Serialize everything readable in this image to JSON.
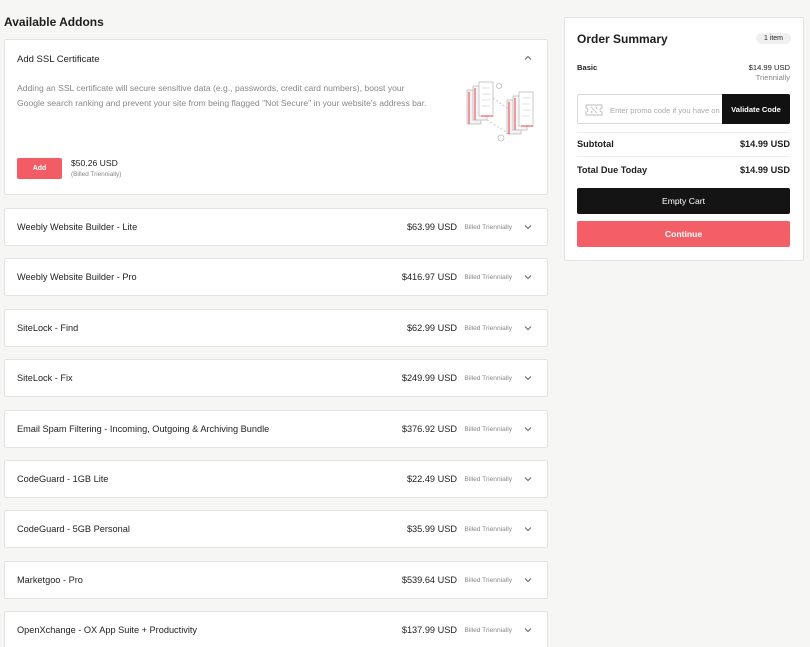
{
  "section_title": "Available Addons",
  "expanded_addon": {
    "name": "Add SSL Certificate",
    "description": "Adding an SSL certificate will secure sensitive data (e.g., passwords, credit card numbers), boost your Google search ranking and prevent your site from being flagged \"Not Secure\" in your website's address bar.",
    "add_label": "Add",
    "price": "$50.26 USD",
    "billing": "(Billed Triennially)",
    "icons": {
      "collapse": "chevron-up-icon",
      "illustration": "ssl-servers-illustration"
    }
  },
  "addons": [
    {
      "name": "Weebly Website Builder - Lite",
      "price": "$63.99 USD",
      "billing": "Billed Triennially"
    },
    {
      "name": "Weebly Website Builder - Pro",
      "price": "$416.97 USD",
      "billing": "Billed Triennially"
    },
    {
      "name": "SiteLock - Find",
      "price": "$62.99 USD",
      "billing": "Billed Triennially"
    },
    {
      "name": "SiteLock - Fix",
      "price": "$249.99 USD",
      "billing": "Billed Triennially"
    },
    {
      "name": "Email Spam Filtering - Incoming, Outgoing & Archiving Bundle",
      "price": "$376.92 USD",
      "billing": "Billed Triennially"
    },
    {
      "name": "CodeGuard - 1GB Lite",
      "price": "$22.49 USD",
      "billing": "Billed Triennially"
    },
    {
      "name": "CodeGuard - 5GB Personal",
      "price": "$35.99 USD",
      "billing": "Billed Triennially"
    },
    {
      "name": "Marketgoo - Pro",
      "price": "$539.64 USD",
      "billing": "Billed Triennially"
    },
    {
      "name": "OpenXchange - OX App Suite + Productivity",
      "price": "$137.99 USD",
      "billing": "Billed Triennially"
    }
  ],
  "summary": {
    "title": "Order Summary",
    "item_count": "1 item",
    "product_name": "Basic",
    "product_price": "$14.99 USD",
    "product_cycle": "Triennially",
    "promo_placeholder": "Enter promo code if you have one",
    "validate_label": "Validate Code",
    "subtotal_label": "Subtotal",
    "subtotal_value": "$14.99 USD",
    "total_label": "Total Due Today",
    "total_value": "$14.99 USD",
    "empty_cart_label": "Empty Cart",
    "continue_label": "Continue",
    "icons": {
      "promo": "ticket-icon"
    }
  },
  "colors": {
    "accent": "#f25c64",
    "dark": "#141414",
    "background": "#f6f6f4"
  }
}
